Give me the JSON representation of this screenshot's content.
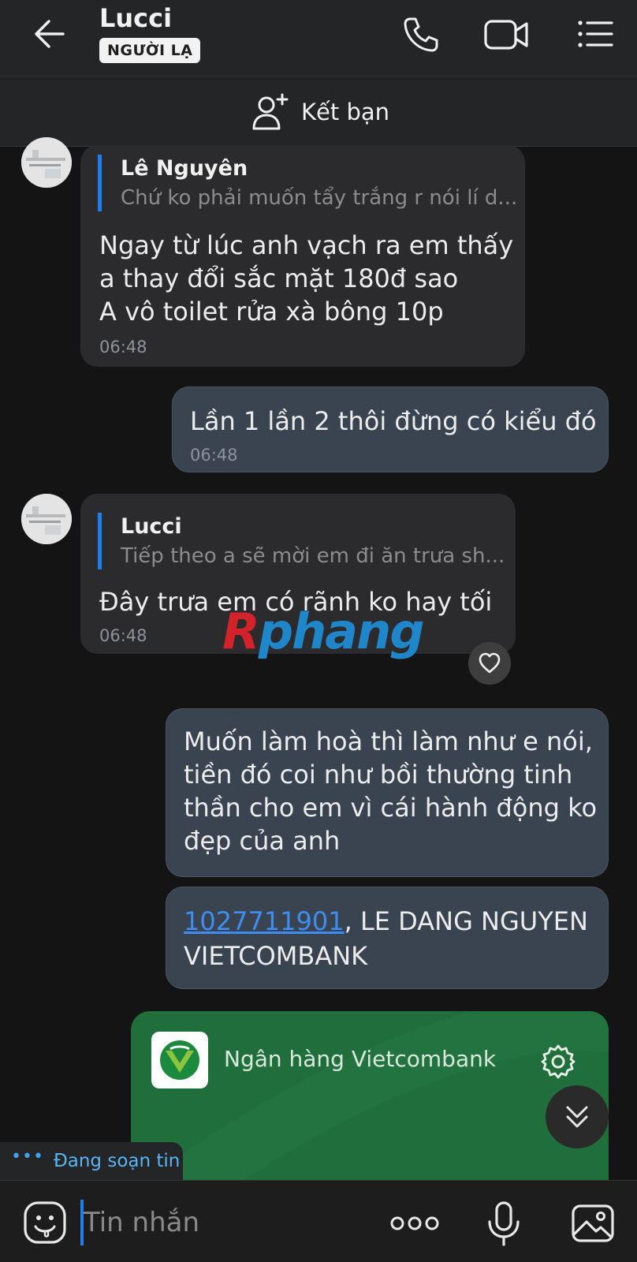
{
  "header": {
    "contact_name": "Lucci",
    "badge": "NGƯỜI LẠ"
  },
  "friend_bar": {
    "add_friend_label": "Kết bạn"
  },
  "messages": [
    {
      "direction": "incoming",
      "quote_name": "Lê Nguyên",
      "quote_text": "Chứ ko phải muốn tẩy trắng r nói lí d...",
      "text": "Ngay từ lúc anh vạch ra em thấy\na thay đổi sắc mặt 180đ sao\nA vô toilet rửa xà bông 10p",
      "time": "06:48"
    },
    {
      "direction": "outgoing",
      "text": "Lần 1 lần 2 thôi đừng có kiểu đó",
      "time": "06:48"
    },
    {
      "direction": "incoming",
      "quote_name": "Lucci",
      "quote_text": "Tiếp theo a sẽ mời em đi ăn trưa sh...",
      "text": "Đây trưa em có rãnh ko hay tối",
      "time": "06:48"
    },
    {
      "direction": "outgoing",
      "text": "Muốn làm hoà thì làm như e nói,\ntiền đó coi như bồi thường tinh\nthần cho em vì cái hành động ko\nđẹp của anh"
    },
    {
      "direction": "outgoing",
      "account_number": "1027711901",
      "text_after_link": ", LE DANG NGUYEN",
      "text_line2": "VIETCOMBANK"
    }
  ],
  "watermark": "Rphang",
  "bank_card": {
    "bank_name": "Ngân hàng Vietcombank",
    "bg_color": "#1f6e3c"
  },
  "typing_indicator": {
    "dots": "•••",
    "text": "Đang soạn tin"
  },
  "input_bar": {
    "placeholder": "Tin nhắn",
    "more_label": "ooo"
  },
  "colors": {
    "accent": "#1e7ef0",
    "outgoing_bubble": "#3a4350",
    "incoming_bubble": "#2b2b2d"
  },
  "icons": [
    "back-arrow-icon",
    "phone-icon",
    "video-call-icon",
    "menu-list-icon",
    "add-friend-icon",
    "heart-icon",
    "gear-icon",
    "chevron-double-down-icon",
    "emoji-icon",
    "more-dots-icon",
    "microphone-icon",
    "image-icon"
  ]
}
